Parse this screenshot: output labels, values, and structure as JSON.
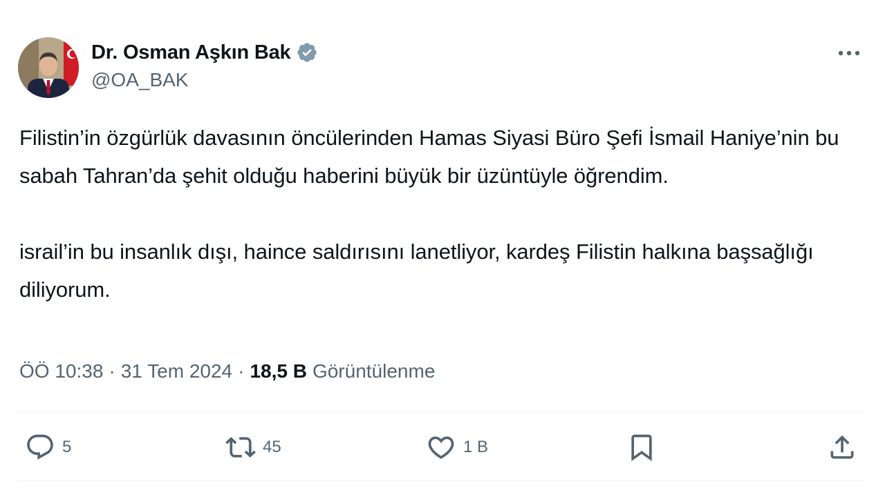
{
  "author": {
    "display_name": "Dr. Osman Aşkın Bak",
    "handle": "@OA_BAK",
    "verified": true
  },
  "tweet": {
    "paragraphs": [
      "Filistin’in özgürlük davasının öncülerinden Hamas Siyasi Büro Şefi İsmail Haniye’nin bu sabah Tahran’da şehit olduğu haberini büyük bir üzüntüyle öğrendim.",
      "israil’in bu insanlık dışı, haince saldırısını lanetliyor, kardeş Filistin halkına başsağlığı diliyorum."
    ]
  },
  "meta": {
    "time": "ÖÖ 10:38",
    "separator": "·",
    "date": "31 Tem 2024",
    "views_count": "18,5 B",
    "views_label": "Görüntülenme"
  },
  "actions": {
    "replies": "5",
    "reposts": "45",
    "likes": "1 B"
  },
  "icons": {
    "verified": "verified-badge-icon",
    "more": "more-dots-icon",
    "reply": "reply-icon",
    "repost": "repost-icon",
    "like": "heart-icon",
    "bookmark": "bookmark-icon",
    "share": "share-icon"
  },
  "colors": {
    "text_primary": "#0f1419",
    "text_secondary": "#536471",
    "verified_badge": "#829aab",
    "divider": "#eff3f4"
  }
}
